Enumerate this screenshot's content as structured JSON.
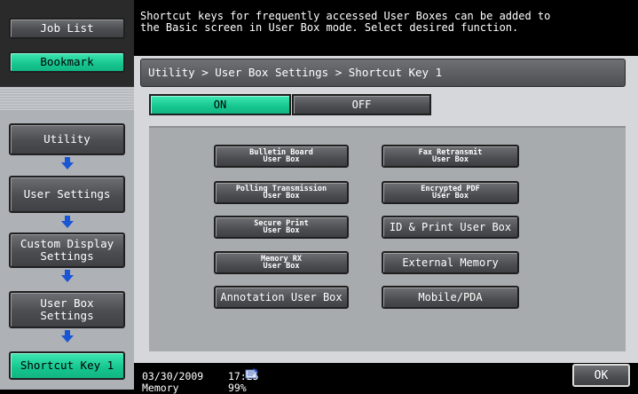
{
  "sidebar": {
    "job_list": "Job List",
    "bookmark": "Bookmark",
    "nav": [
      {
        "label": "Utility"
      },
      {
        "label": "User Settings"
      },
      {
        "label": "Custom Display Settings"
      },
      {
        "label": "User Box Settings"
      },
      {
        "label": "Shortcut Key 1"
      }
    ]
  },
  "message": "Shortcut keys for frequently accessed User Boxes can be added to\nthe Basic screen in User Box mode. Select desired function.",
  "breadcrumb": "Utility > User Box Settings > Shortcut Key 1",
  "toggle": {
    "on": "ON",
    "off": "OFF",
    "selected": "ON"
  },
  "functions": {
    "bulletin": "Bulletin Board\nUser Box",
    "polling": "Polling Transmission\nUser Box",
    "secure": "Secure Print\nUser Box",
    "memory_rx": "Memory RX\nUser Box",
    "annotation": "Annotation User Box",
    "fax_retransmit": "Fax Retransmit\nUser Box",
    "encrypted": "Encrypted PDF\nUser Box",
    "id_print": "ID & Print User Box",
    "external": "External Memory",
    "mobile": "Mobile/PDA",
    "selected": "Bulletin Board User Box"
  },
  "status": {
    "date": "03/30/2009",
    "time": "17:25",
    "memory_label": "Memory",
    "memory_value": "99%",
    "ok": "OK"
  },
  "colors": {
    "accent_green": "#16c58e",
    "panel_gray": "#d5d7da",
    "button_gray": "#4b4d50"
  }
}
